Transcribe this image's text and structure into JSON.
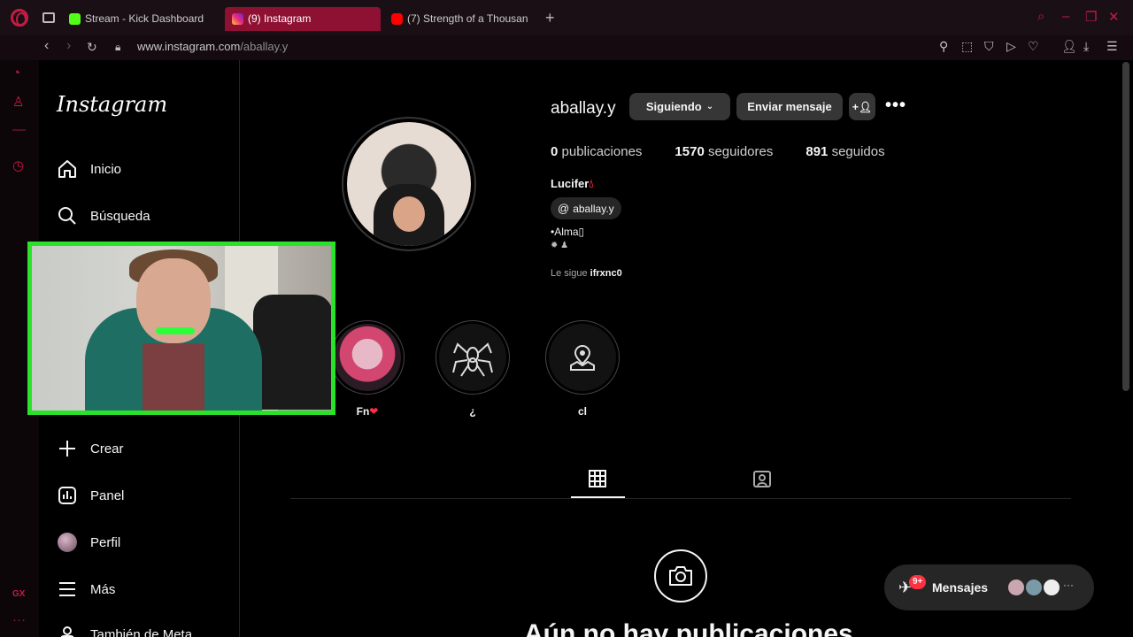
{
  "browser": {
    "tabs": [
      {
        "label": "Stream - Kick Dashboard",
        "favicon_color": "#53fc18"
      },
      {
        "label": "(9) Instagram",
        "favicon_color": "#e1306c"
      },
      {
        "label": "(7) Strength of a Thousan",
        "favicon_color": "#ff0000"
      }
    ],
    "url_host": "www.instagram.com",
    "url_path": "/aballay.y"
  },
  "nav": {
    "logo": "Instagram",
    "items": [
      {
        "label": "Inicio",
        "icon": "home-icon"
      },
      {
        "label": "Búsqueda",
        "icon": "search-icon"
      },
      {
        "label": "Crear",
        "icon": "plus-icon"
      },
      {
        "label": "Panel",
        "icon": "dashboard-icon"
      },
      {
        "label": "Perfil",
        "icon": "avatar"
      },
      {
        "label": "Más",
        "icon": "menu-icon"
      },
      {
        "label": "También de Meta",
        "icon": "meta-icon"
      }
    ]
  },
  "profile": {
    "username": "aballay.y",
    "following_btn": "Siguiendo",
    "message_btn": "Enviar mensaje",
    "stats": {
      "posts_count": "0",
      "posts_label": "publicaciones",
      "followers_count": "1570",
      "followers_label": "seguidores",
      "following_count": "891",
      "following_label": "seguidos"
    },
    "name": "Lucifer",
    "threads_handle": "aballay.y",
    "bio_line1": "•Alma",
    "followed_by_prefix": "Le sigue",
    "followed_by_user": "ifrxnc0"
  },
  "highlights": [
    {
      "label": "Fn"
    },
    {
      "label": "¿"
    },
    {
      "label": "cl"
    }
  ],
  "empty_state": {
    "title": "Aún no hay publicaciones"
  },
  "messages": {
    "label": "Mensajes",
    "badge": "9+"
  },
  "colors": {
    "accent": "#c41b45",
    "webcam_border": "#29e229",
    "ig_background": "#000000",
    "button_bg": "#363636",
    "badge": "#ff3040"
  }
}
